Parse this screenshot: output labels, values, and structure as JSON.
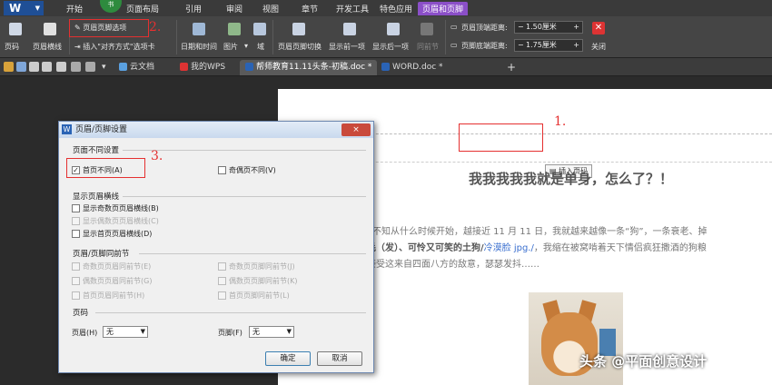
{
  "app": {
    "logo": "W",
    "menu_tabs": [
      "开始",
      "页面布局",
      "引用",
      "审阅",
      "视图",
      "章节",
      "开发工具",
      "特色应用",
      "页眉和页脚"
    ],
    "active_tab": "页眉和页脚",
    "badge": "书"
  },
  "ribbon": {
    "items": [
      "页码",
      "页眉横线",
      "页眉页脚选项",
      "插入\"对齐方式\"选项卡",
      "日期和时间",
      "图片",
      "域",
      "页眉页脚切换",
      "显示前一项",
      "显示后一项",
      "同前节",
      "关闭"
    ],
    "header_top_label": "页眉顶端距离:",
    "header_top_value": "1.50厘米",
    "footer_bottom_label": "页脚底端距离:",
    "footer_bottom_value": "1.75厘米",
    "minus": "−",
    "plus": "+"
  },
  "annotations": {
    "n1": "1.",
    "n2": "2.",
    "n3": "3."
  },
  "tabbar": {
    "tabs": [
      "云文档",
      "我的WPS",
      "帮师教育11.11头条-初稿.doc *",
      "WORD.doc *"
    ],
    "new_tab": "+"
  },
  "document": {
    "insert_page_number": "插入页码",
    "headline": "我我我我我就是单身，怎么了？！",
    "line1": "不知从什么时候开始，越接近 11 月 11 日，我就越来越像一条“狗”，一条衰老、掉",
    "line2_bold": "毛（发）、可怜又可笑的土狗/",
    "line2_blue": "冷漠脸 jpg./",
    "line2_rest": "，我缩在被窝啃着天下情侣疯狂撒酒的狗粮",
    "line3": "接受这来自四面八方的敌意，瑟瑟发抖……"
  },
  "watermark": "头条 @平面创意设计",
  "dialog": {
    "title": "页眉/页脚设置",
    "close": "×",
    "group_diff": "页面不同设置",
    "first_page_diff": "首页不同(A)",
    "odd_even_diff": "奇偶页不同(V)",
    "group_rules": "显示页眉横线",
    "rule_odd": "显示奇数页页眉横线(B)",
    "rule_even": "显示偶数页页眉横线(C)",
    "rule_first": "显示首页页眉横线(D)",
    "group_link": "页眉/页脚同前节",
    "odd_header_link": "奇数页页眉同前节(E)",
    "odd_footer_link": "奇数页页脚同前节(J)",
    "even_header_link": "偶数页页眉同前节(G)",
    "even_footer_link": "偶数页页脚同前节(K)",
    "first_header_link": "首页页眉同前节(H)",
    "first_footer_link": "首页页脚同前节(L)",
    "group_pn": "页码",
    "header_label": "页眉(H)",
    "header_value": "无",
    "footer_label": "页脚(F)",
    "footer_value": "无",
    "ok": "确定",
    "cancel": "取消",
    "first_page_checked": "✓"
  }
}
